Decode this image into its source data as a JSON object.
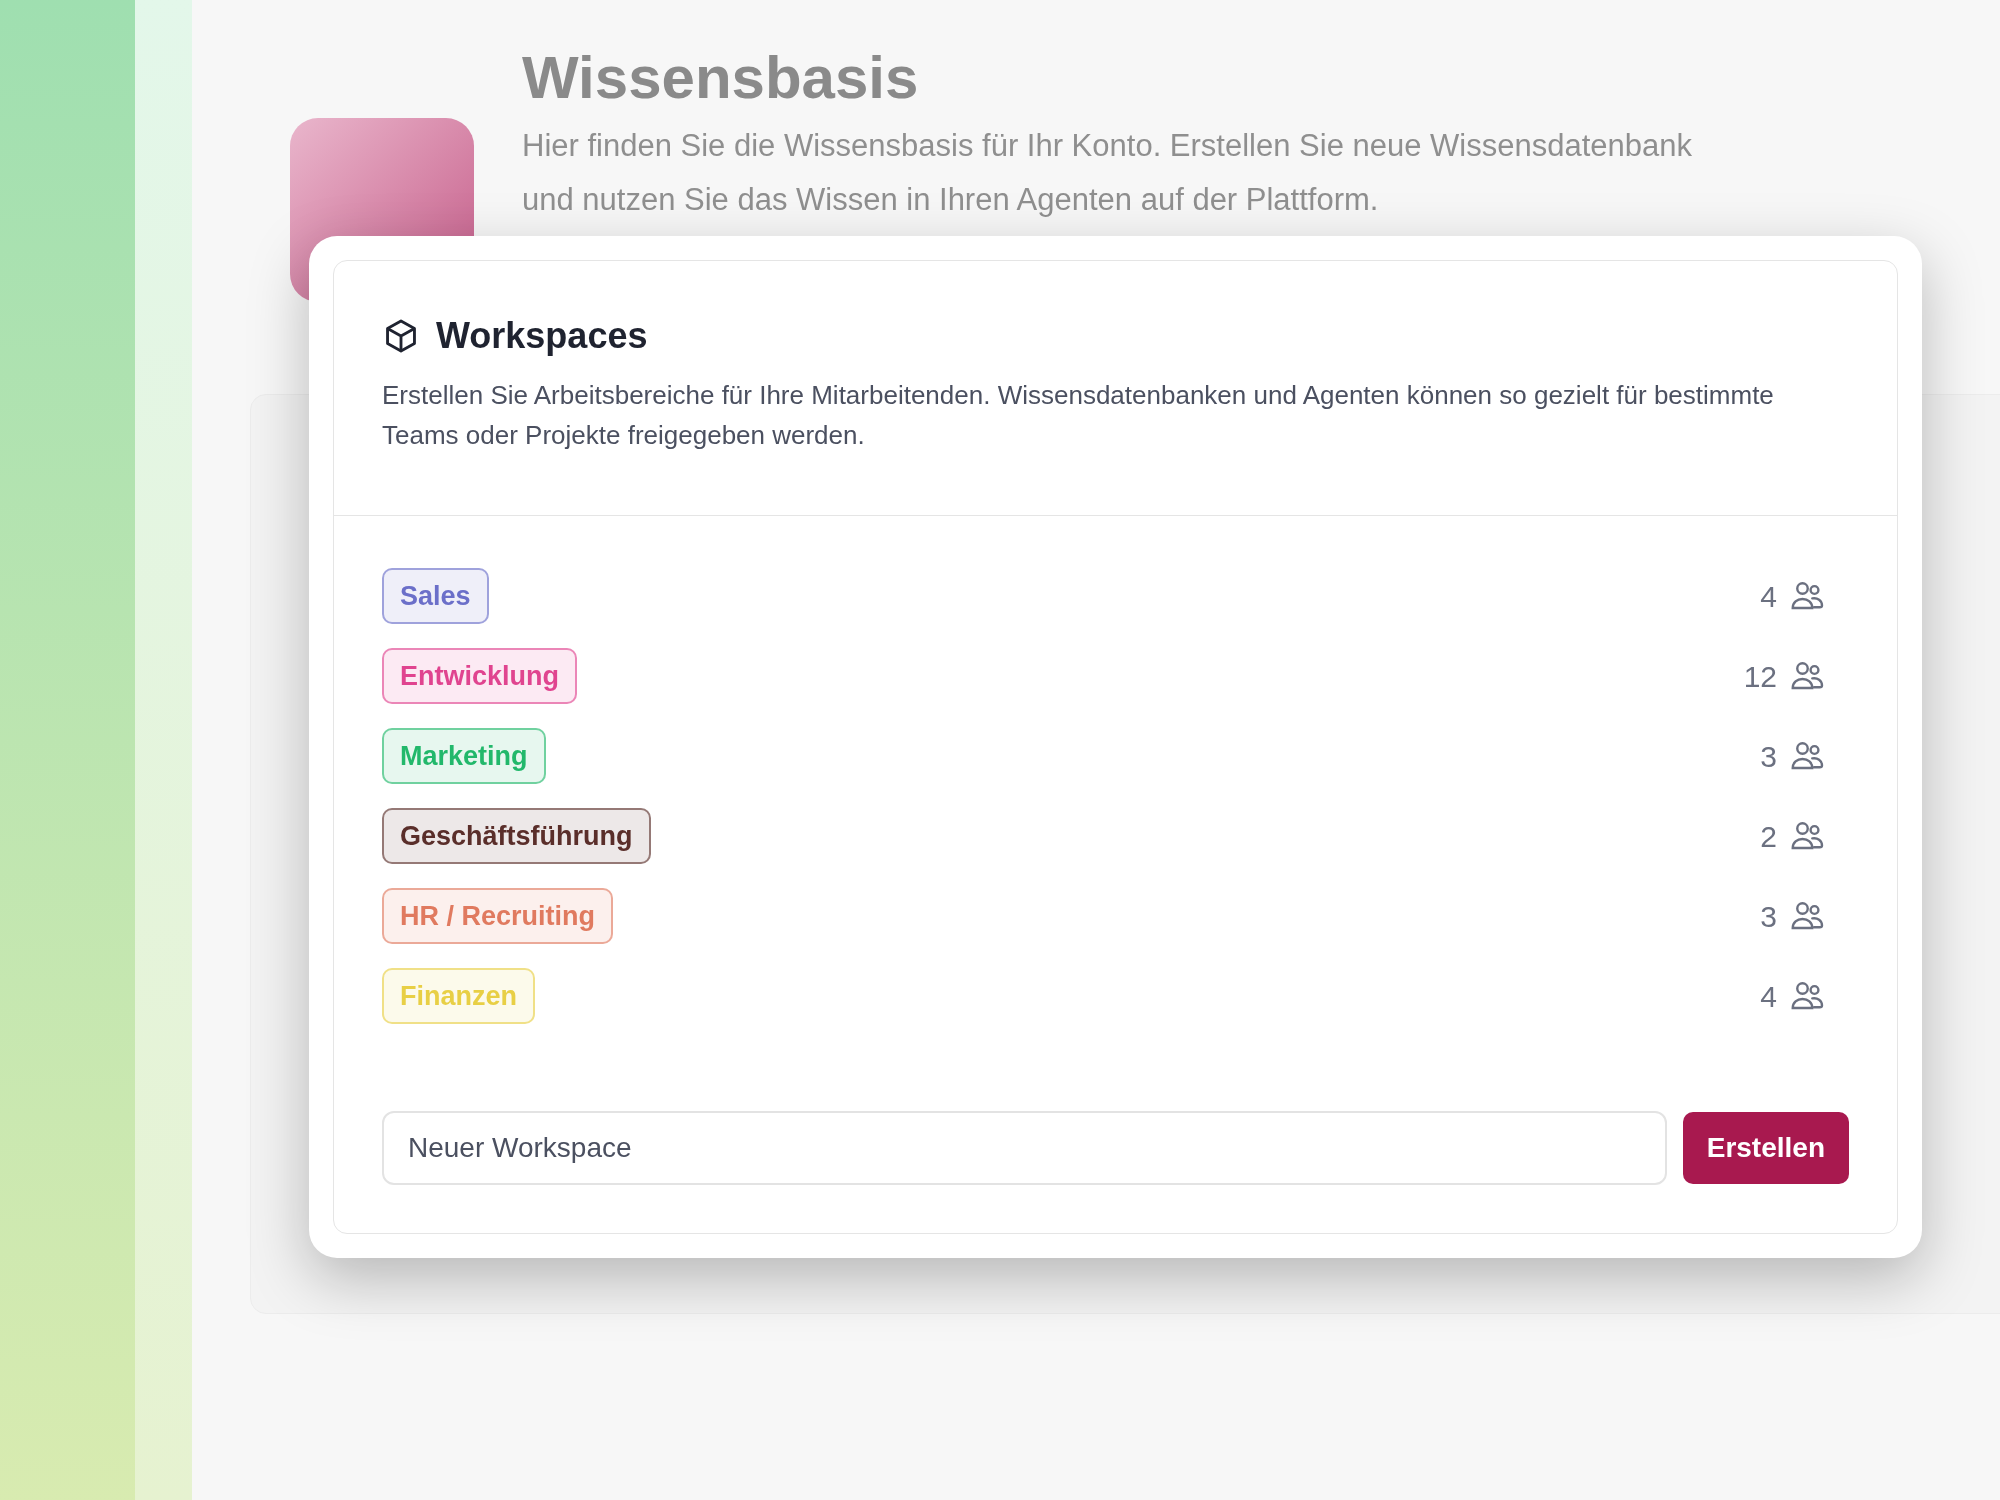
{
  "page": {
    "title": "Wissensbasis",
    "description_lines": [
      "Hier finden Sie die Wissensbasis für Ihr Konto. Erstellen Sie neue Wissensdatenbank",
      "und nutzen Sie das Wissen in Ihren Agenten auf der Plattform."
    ]
  },
  "dialog": {
    "title": "Workspaces",
    "description": "Erstellen Sie Arbeitsbereiche für Ihre Mitarbeitenden. Wissensdatenbanken und Agenten können so gezielt für bestimmte Teams oder Projekte freigegeben werden.",
    "workspaces": [
      {
        "name": "Sales",
        "members": "4",
        "color": "#6b6fc9"
      },
      {
        "name": "Entwicklung",
        "members": "12",
        "color": "#e0448f"
      },
      {
        "name": "Marketing",
        "members": "3",
        "color": "#22b86b"
      },
      {
        "name": "Geschäftsführung",
        "members": "2",
        "color": "#5a2e2a"
      },
      {
        "name": "HR / Recruiting",
        "members": "3",
        "color": "#e07a5f"
      },
      {
        "name": "Finanzen",
        "members": "4",
        "color": "#e8cf45"
      }
    ],
    "input": {
      "placeholder": "Neuer Workspace"
    },
    "button": "Erstellen"
  }
}
